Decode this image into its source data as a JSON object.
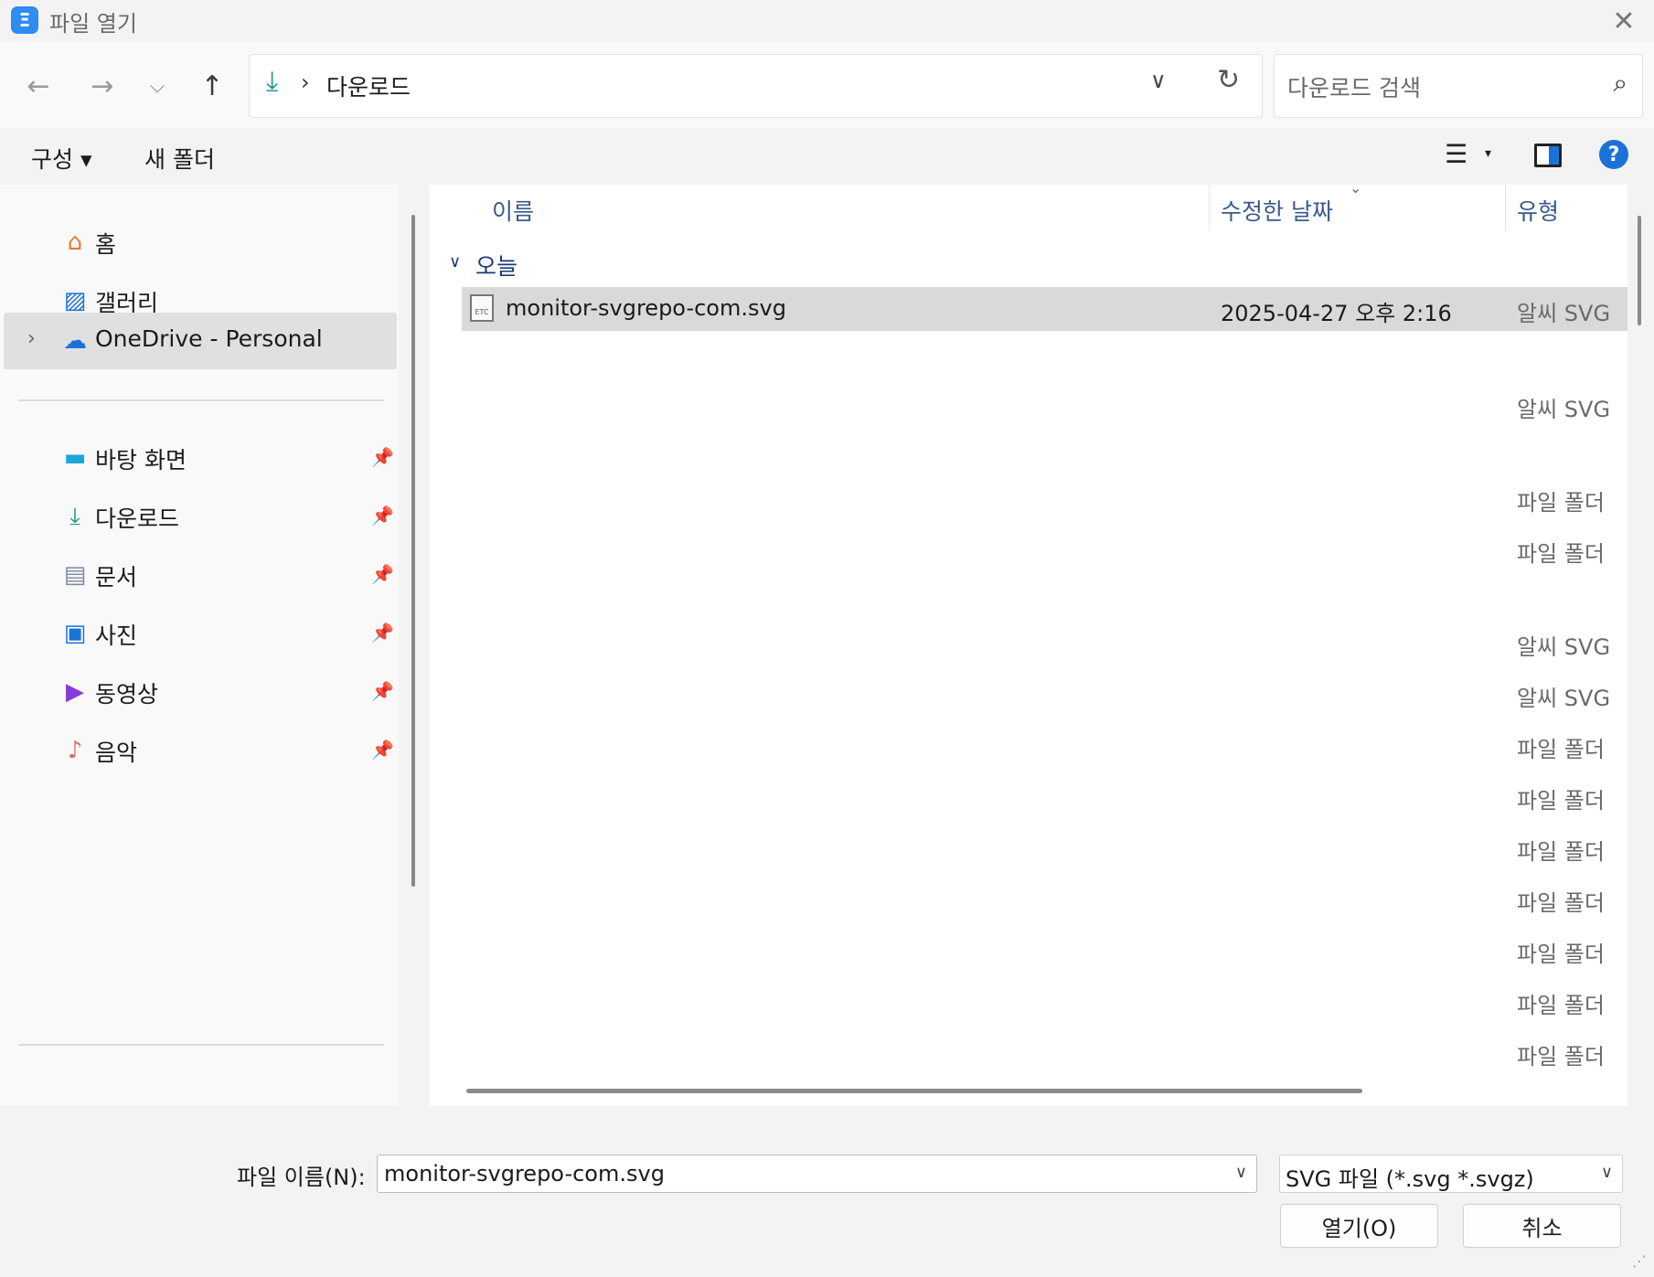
{
  "window": {
    "title": "파일 열기",
    "app_icon_glyph": "Ξ",
    "close_icon": "close-icon"
  },
  "nav": {
    "back_icon": "arrow-left-icon",
    "forward_icon": "arrow-right-icon",
    "recent_icon": "chevron-down-icon",
    "up_icon": "arrow-up-icon"
  },
  "address": {
    "location": "다운로드",
    "separator": "›"
  },
  "search": {
    "placeholder": "다운로드 검색"
  },
  "commands": {
    "organize": "구성 ▾",
    "new_folder": "새 폴더"
  },
  "sidebar": {
    "quick": [
      {
        "label": "홈",
        "icon": "home-icon"
      },
      {
        "label": "갤러리",
        "icon": "gallery-icon"
      },
      {
        "label": "OneDrive - Personal",
        "icon": "onedrive-cloud-icon"
      }
    ],
    "pinned": [
      {
        "label": "바탕 화면",
        "icon": "desktop-icon"
      },
      {
        "label": "다운로드",
        "icon": "download-icon"
      },
      {
        "label": "문서",
        "icon": "documents-icon"
      },
      {
        "label": "사진",
        "icon": "pictures-icon"
      },
      {
        "label": "동영상",
        "icon": "videos-icon"
      },
      {
        "label": "음악",
        "icon": "music-icon"
      }
    ]
  },
  "columns": {
    "name": "이름",
    "modified": "수정한 날짜",
    "type": "유형"
  },
  "group": {
    "label": "오늘"
  },
  "files": [
    {
      "name": "monitor-svgrepo-com.svg",
      "modified": "2025-04-27 오후 2:16",
      "type": "알씨 SVG 파일"
    }
  ],
  "other_types": [
    "알씨 SVG 파일",
    "파일 폴더",
    "파일 폴더",
    "알씨 SVG 파일",
    "알씨 SVG 파일",
    "파일 폴더",
    "파일 폴더",
    "파일 폴더",
    "파일 폴더",
    "파일 폴더",
    "파일 폴더",
    "파일 폴더"
  ],
  "footer": {
    "filename_label": "파일 이름(N):",
    "filename_value": "monitor-svgrepo-com.svg",
    "filter_value": "SVG 파일 (*.svg *.svgz)",
    "open_label": "열기(O)",
    "cancel_label": "취소"
  },
  "colors": {
    "accent": "#1a72d8",
    "selected_row": "#d9d9d9",
    "download_icon": "#1a9a8a"
  }
}
